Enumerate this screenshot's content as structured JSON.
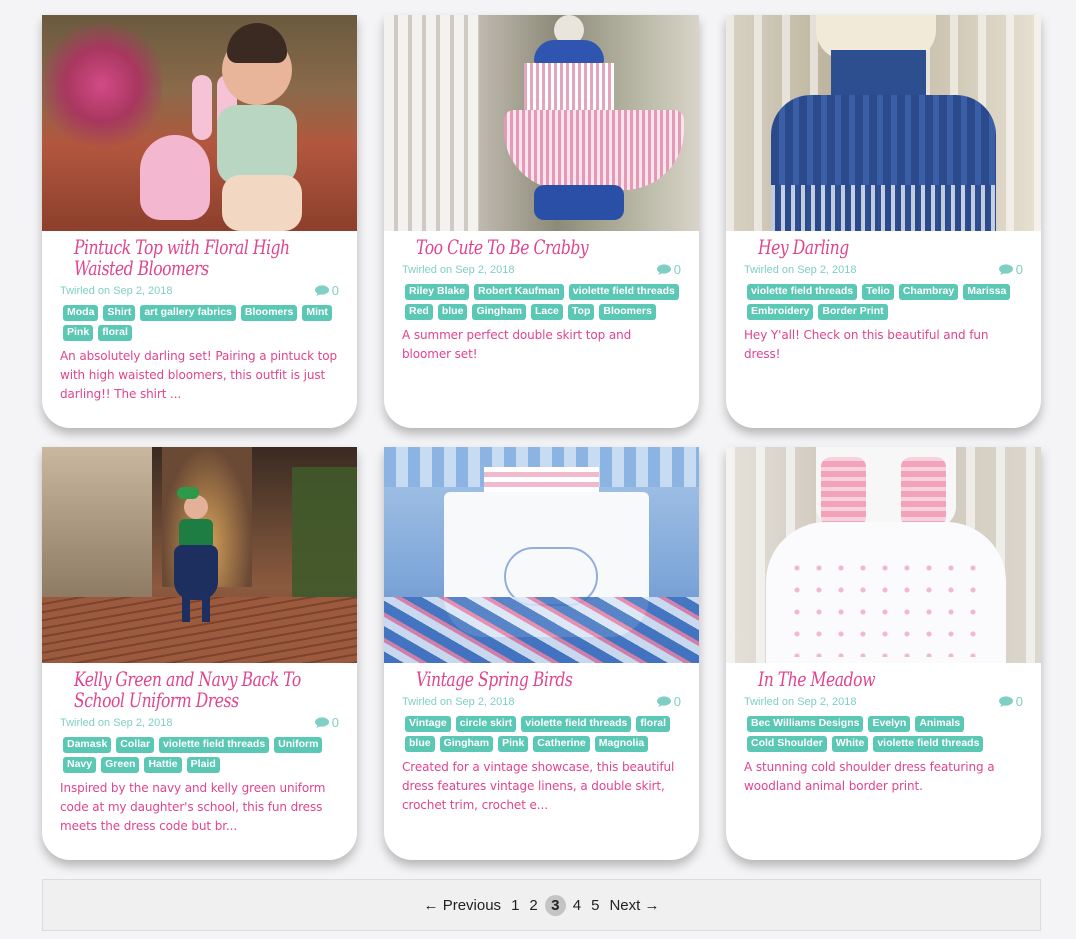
{
  "posts": [
    {
      "title": "Pintuck Top with Floral High Waisted Bloomers",
      "date": "Twirled on Sep 2, 2018",
      "comments": "0",
      "tags": [
        "Moda",
        "Shirt",
        "art gallery fabrics",
        "Bloomers",
        "Mint",
        "Pink",
        "floral"
      ],
      "excerpt": "An absolutely darling set! Pairing a pintuck top with high waisted bloomers, this outfit is just darling!! The shirt ..."
    },
    {
      "title": "Too Cute To Be Crabby",
      "date": "Twirled on Sep 2, 2018",
      "comments": "0",
      "tags": [
        "Riley Blake",
        "Robert Kaufman",
        "violette field threads",
        "Red",
        "blue",
        "Gingham",
        "Lace",
        "Top",
        "Bloomers"
      ],
      "excerpt": "A summer perfect double skirt top and bloomer set!"
    },
    {
      "title": "Hey Darling",
      "date": "Twirled on Sep 2, 2018",
      "comments": "0",
      "tags": [
        "violette field threads",
        "Telio",
        "Chambray",
        "Marissa",
        "Embroidery",
        "Border Print"
      ],
      "excerpt": "Hey Y'all! Check on this beautiful and fun dress!"
    },
    {
      "title": "Kelly Green and Navy Back To School Uniform Dress",
      "date": "Twirled on Sep 2, 2018",
      "comments": "0",
      "tags": [
        "Damask",
        "Collar",
        "violette field threads",
        "Uniform",
        "Navy",
        "Green",
        "Hattie",
        "Plaid"
      ],
      "excerpt": "Inspired by the navy and kelly green uniform code at my daughter's school, this fun dress meets the dress code but br..."
    },
    {
      "title": "Vintage Spring Birds",
      "date": "Twirled on Sep 2, 2018",
      "comments": "0",
      "tags": [
        "Vintage",
        "circle skirt",
        "violette field threads",
        "floral",
        "blue",
        "Gingham",
        "Pink",
        "Catherine",
        "Magnolia"
      ],
      "excerpt": "Created for a vintage showcase, this beautiful dress features vintage linens, a double skirt, crochet trim, crochet e..."
    },
    {
      "title": "In The Meadow",
      "date": "Twirled on Sep 2, 2018",
      "comments": "0",
      "tags": [
        "Bec Williams Designs",
        "Evelyn",
        "Animals",
        "Cold Shoulder",
        "White",
        "violette field threads"
      ],
      "excerpt": "A stunning cold shoulder dress featuring a woodland animal border print."
    }
  ],
  "pagination": {
    "previous": "← Previous",
    "pages": [
      "1",
      "2",
      "3",
      "4",
      "5"
    ],
    "current": "3",
    "next": "Next →"
  },
  "icons": {
    "comment": "comment-bubble-icon"
  },
  "colors": {
    "accent_pink": "#e0448f",
    "tag_teal": "#5bc7b5",
    "meta_teal": "#7fcfc4"
  }
}
